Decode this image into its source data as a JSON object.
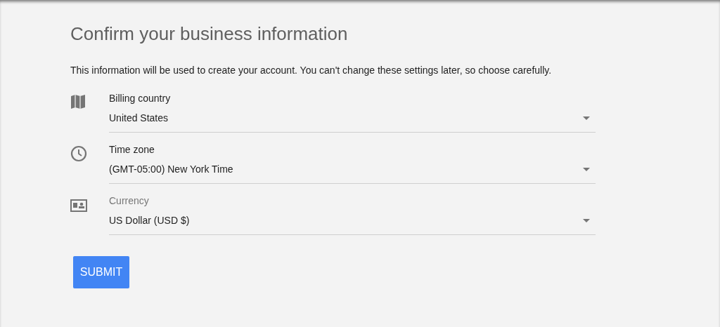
{
  "title": "Confirm your business information",
  "description": "This information will be used to create your account. You can't change these settings later, so choose carefully.",
  "fields": [
    {
      "kind": "map",
      "label": "Billing country",
      "value": "United States",
      "label_dimmed": false
    },
    {
      "kind": "clock",
      "label": "Time zone",
      "value": "(GMT-05:00) New York Time",
      "label_dimmed": false
    },
    {
      "kind": "currency",
      "label": "Currency",
      "value": "US Dollar (USD $)",
      "label_dimmed": true
    }
  ],
  "submit": "SUBMIT"
}
